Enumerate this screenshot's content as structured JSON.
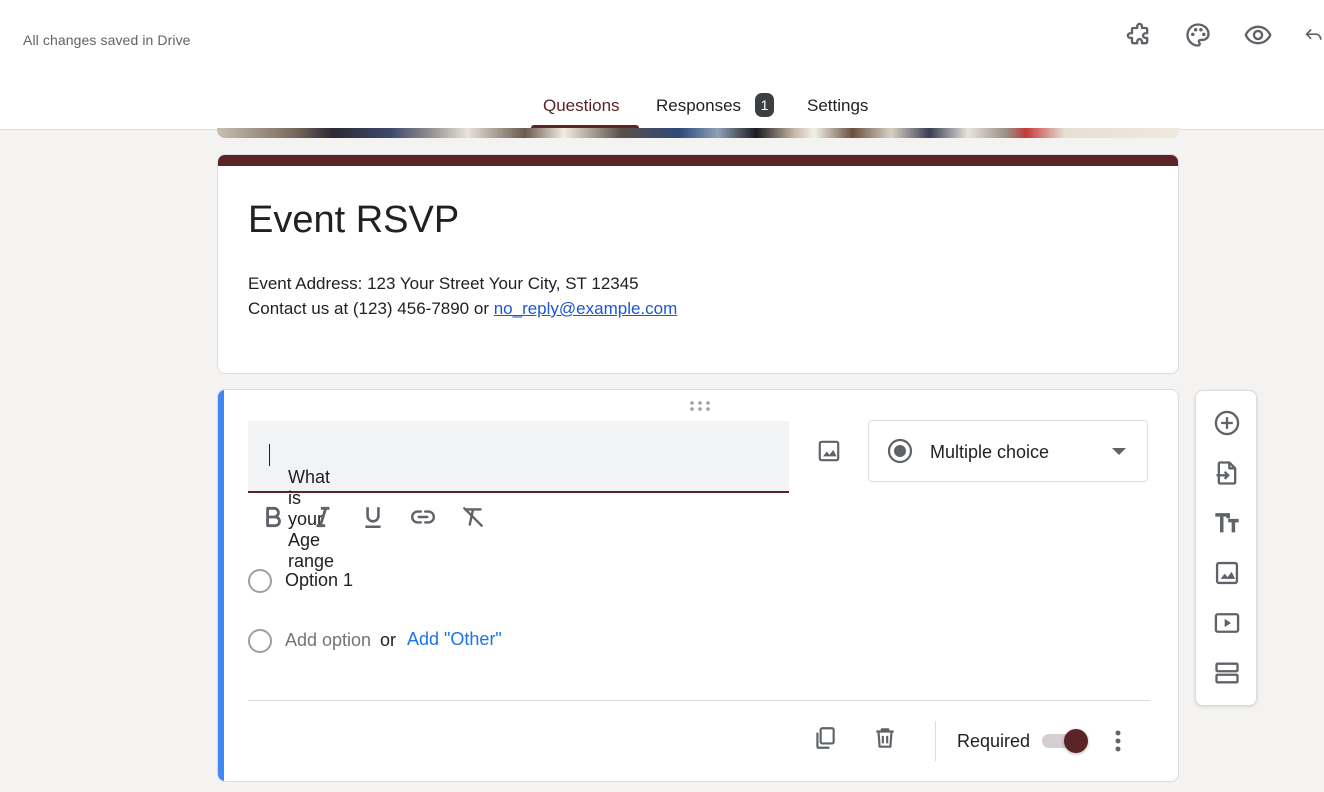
{
  "header": {
    "save_status": "All changes saved in Drive",
    "icons": [
      "addons-icon",
      "palette-icon",
      "preview-eye-icon",
      "undo-icon"
    ]
  },
  "tabs": [
    {
      "label": "Questions",
      "active": true
    },
    {
      "label": "Responses",
      "badge": "1"
    },
    {
      "label": "Settings"
    }
  ],
  "form": {
    "title": "Event RSVP",
    "description_line1": "Event Address: 123 Your Street Your City, ST 12345",
    "description_line2_prefix": "Contact us at (123) 456-7890 or ",
    "contact_email": "no_reply@example.com"
  },
  "question": {
    "text": "What is your Age range",
    "type": "Multiple choice",
    "options": [
      "Option 1"
    ],
    "add_option": "Add option",
    "or": "or",
    "add_other": "Add \"Other\"",
    "required_label": "Required",
    "required": true
  },
  "colors": {
    "theme": "#5b2427",
    "focus_accent": "#4285f4",
    "link": "#1a56d6"
  }
}
